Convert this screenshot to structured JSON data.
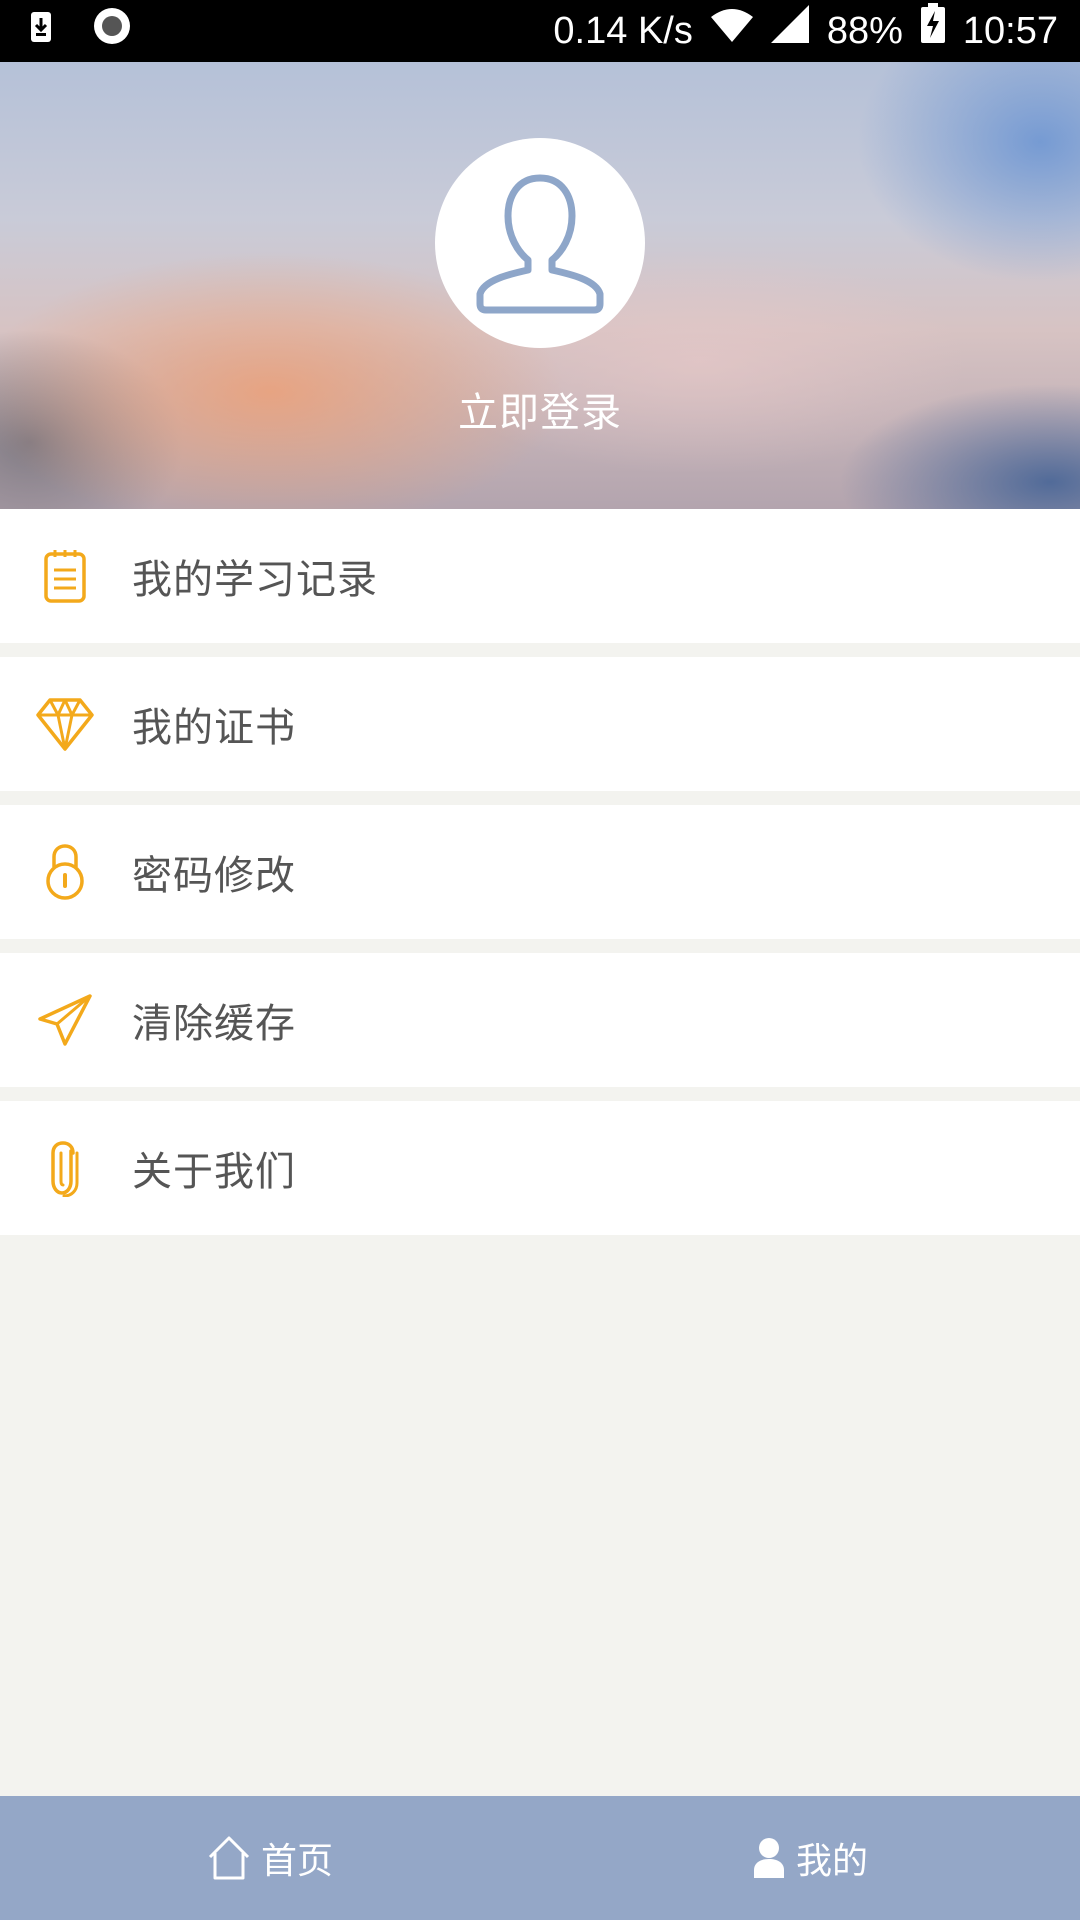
{
  "status_bar": {
    "net_speed": "0.14 K/s",
    "battery": "88%",
    "time": "10:57",
    "icons": [
      "download-icon",
      "record-icon",
      "wifi-icon",
      "signal-icon",
      "battery-charging-icon"
    ]
  },
  "header": {
    "login_label": "立即登录",
    "avatar_icon": "user-avatar-icon"
  },
  "menu": {
    "items": [
      {
        "label": "我的学习记录",
        "icon": "clipboard-icon"
      },
      {
        "label": "我的证书",
        "icon": "diamond-icon"
      },
      {
        "label": "密码修改",
        "icon": "lock-icon"
      },
      {
        "label": "清除缓存",
        "icon": "paper-plane-icon"
      },
      {
        "label": "关于我们",
        "icon": "paperclip-icon"
      }
    ]
  },
  "bottom_nav": {
    "tabs": [
      {
        "label": "首页",
        "icon": "home-icon"
      },
      {
        "label": "我的",
        "icon": "user-icon"
      }
    ]
  },
  "colors": {
    "accent": "#f3a91b",
    "nav_bg": "#94a7c7",
    "avatar_stroke": "#8ea6c9"
  }
}
